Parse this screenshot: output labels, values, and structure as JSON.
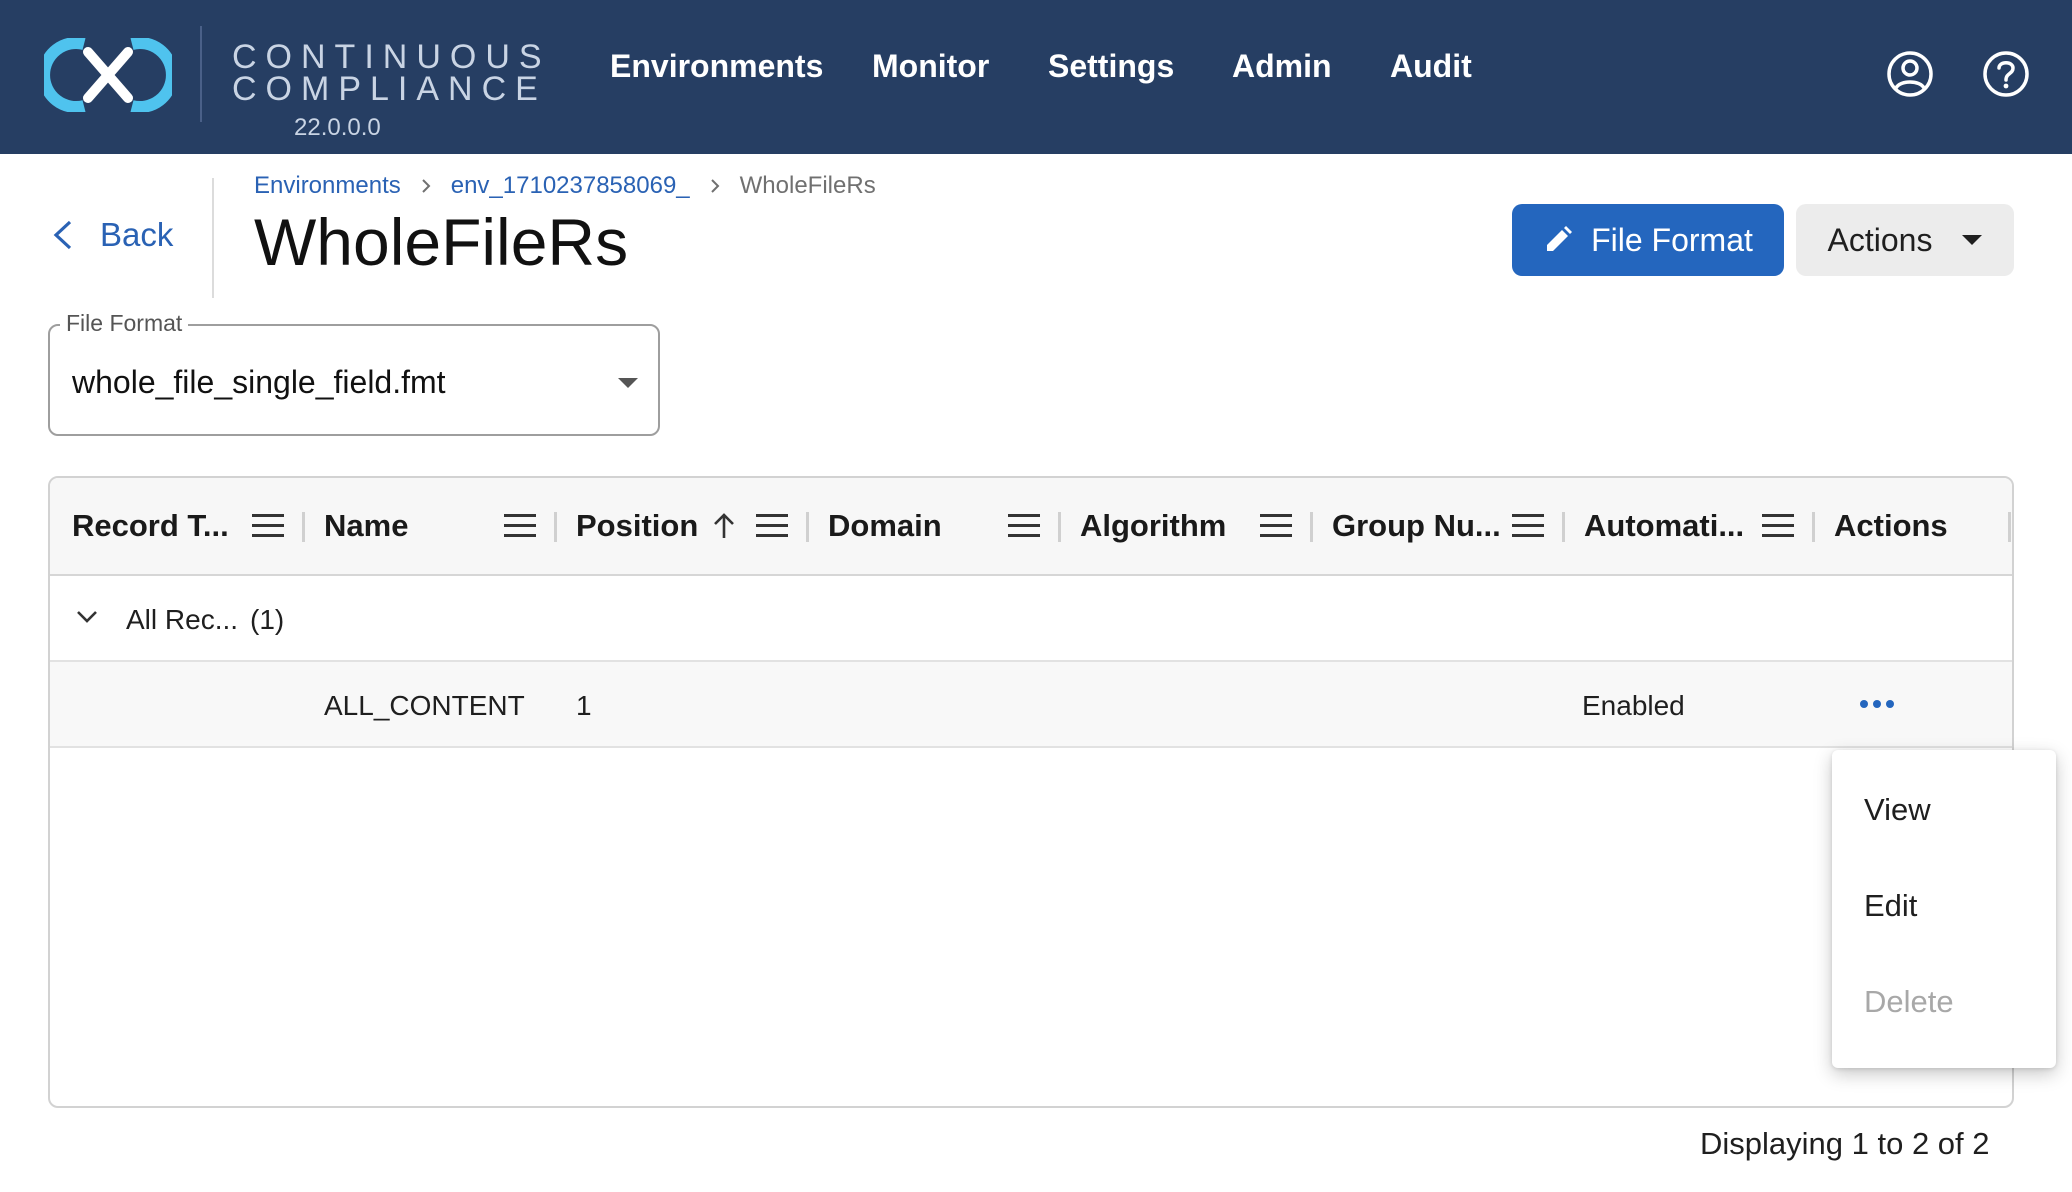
{
  "app": {
    "brand_line1": "CONTINUOUS",
    "brand_line2": "COMPLIANCE",
    "version": "22.0.0.0",
    "nav": [
      "Environments",
      "Monitor",
      "Settings",
      "Admin",
      "Audit"
    ],
    "icons": {
      "logo": "delphix-logo",
      "user": "user-circle-icon",
      "help": "help-circle-icon"
    },
    "colors": {
      "topbar": "#263e63",
      "accent": "#2466be",
      "logo": "#4fc3ee"
    }
  },
  "header": {
    "back_label": "Back",
    "breadcrumb": [
      "Environments",
      "env_1710237858069_",
      "WholeFileRs"
    ],
    "title": "WholeFileRs",
    "file_format_button": "File Format",
    "actions_button": "Actions"
  },
  "file_format_select": {
    "label": "File Format",
    "value": "whole_file_single_field.fmt"
  },
  "grid": {
    "columns": [
      "Record T...",
      "Name",
      "Position",
      "Domain",
      "Algorithm",
      "Group Nu...",
      "Automati...",
      "Actions"
    ],
    "sort": {
      "column": "Position",
      "direction": "ascending"
    },
    "group": {
      "label": "All Rec...",
      "count": "(1)"
    },
    "rows": [
      {
        "record_type": "",
        "name": "ALL_CONTENT",
        "position": "1",
        "domain": "",
        "algorithm": "",
        "group_number": "",
        "automation": "Enabled"
      }
    ]
  },
  "row_menu": {
    "items": [
      "View",
      "Edit",
      "Delete"
    ],
    "disabled": [
      "Delete"
    ]
  },
  "footer": {
    "count_text": "Displaying 1 to 2 of 2"
  }
}
